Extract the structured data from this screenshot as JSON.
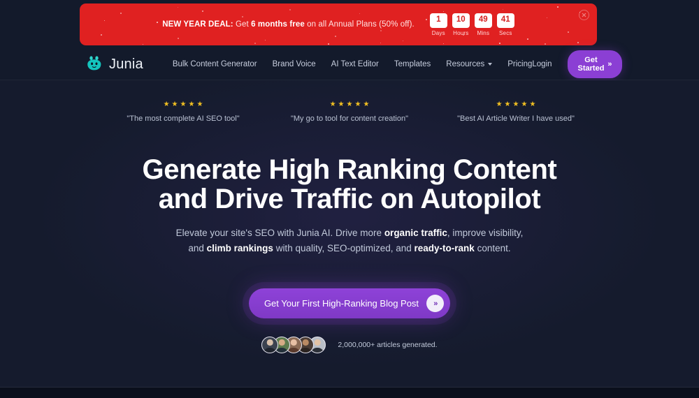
{
  "banner": {
    "prefix": "NEW YEAR DEAL:",
    "text_part1": " Get ",
    "highlight": "6 months free",
    "text_part2": " on all Annual Plans (50% off).",
    "close_icon": "close-icon",
    "bg_color": "#e02121",
    "countdown": [
      {
        "value": "1",
        "label": "Days"
      },
      {
        "value": "10",
        "label": "Hours"
      },
      {
        "value": "49",
        "label": "Mins"
      },
      {
        "value": "41",
        "label": "Secs"
      }
    ]
  },
  "nav": {
    "logo_text": "Junia",
    "logo_icon": "junia-mascot-icon",
    "logo_color": "#2fd6cd",
    "links": [
      {
        "label": "Bulk Content Generator",
        "has_caret": false
      },
      {
        "label": "Brand Voice",
        "has_caret": false
      },
      {
        "label": "AI Text Editor",
        "has_caret": false
      },
      {
        "label": "Templates",
        "has_caret": false
      },
      {
        "label": "Resources",
        "has_caret": true
      },
      {
        "label": "Pricing",
        "has_caret": false
      }
    ],
    "login_label": "Login",
    "cta_label": "Get Started",
    "cta_icon": "double-chevron-right-icon",
    "cta_color": "#8b3fd4"
  },
  "testimonials": [
    {
      "stars": 5,
      "quote": "\"The most complete AI SEO tool\""
    },
    {
      "stars": 5,
      "quote": "\"My go to tool for content creation\""
    },
    {
      "stars": 5,
      "quote": "\"Best AI Article Writer I have used\""
    }
  ],
  "hero": {
    "headline_line1": "Generate High Ranking Content",
    "headline_line2": "and Drive Traffic on Autopilot",
    "subtitle_1": "Elevate your site's SEO with Junia AI. Drive more ",
    "subtitle_b1": "organic traffic",
    "subtitle_2": ", improve visibility, and ",
    "subtitle_b2": "climb rankings",
    "subtitle_3": " with quality, SEO-optimized, and ",
    "subtitle_b3": "ready-to-rank",
    "subtitle_4": " content.",
    "cta_label": "Get Your First High-Ranking Blog Post",
    "cta_icon": "double-chevron-right-icon",
    "proof_text": "2,000,000+ articles generated.",
    "avatar_count": 5,
    "star_color": "#f2c022",
    "accent_color": "#8b3fd4",
    "bg_color": "#131a2b"
  }
}
